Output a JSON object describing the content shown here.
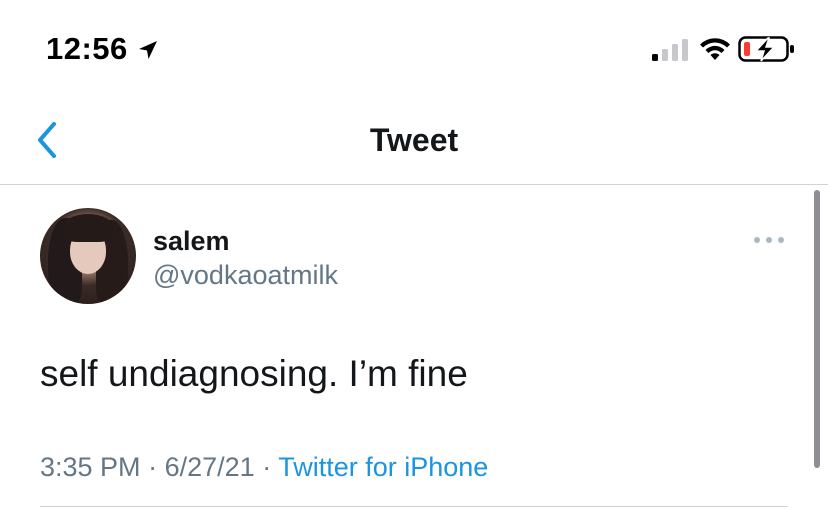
{
  "status_bar": {
    "time": "12:56",
    "icons": [
      "location-arrow-icon",
      "cellular-signal-icon",
      "wifi-icon",
      "battery-charging-icon"
    ],
    "battery_color": "#ff3b30"
  },
  "nav": {
    "title": "Tweet",
    "back_icon": "chevron-left-icon",
    "accent_color": "#1b95e0"
  },
  "tweet": {
    "display_name": "salem",
    "handle": "@vodkaoatmilk",
    "text": "self undiagnosing. I’m fine",
    "time": "3:35 PM",
    "separator": "·",
    "date": "6/27/21",
    "source": "Twitter for iPhone",
    "more_icon": "more-horizontal-icon"
  }
}
